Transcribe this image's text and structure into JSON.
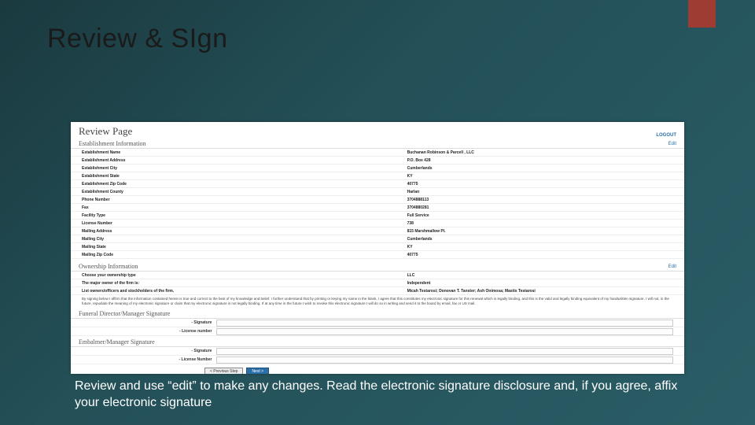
{
  "slide": {
    "title": "Review & SIgn",
    "caption": "Review and use “edit” to make any changes.  Read the electronic signature disclosure and, if you agree, affix your electronic signature"
  },
  "page": {
    "header": "Review Page",
    "logout": "LOGOUT",
    "section1_title": "Establishment Information",
    "edit": "Edit",
    "rows": [
      {
        "k": "Establishment Name",
        "v": "Buchanan Robinson & Parcell , LLC"
      },
      {
        "k": "Establishment Address",
        "v": "P.O. Box 428"
      },
      {
        "k": "Establishment City",
        "v": "Cumberlands"
      },
      {
        "k": "Establishment State",
        "v": "KY"
      },
      {
        "k": "Establishment Zip Code",
        "v": "40775"
      },
      {
        "k": "Establishment County",
        "v": "Harlan"
      },
      {
        "k": "Phone Number",
        "v": "3704888113"
      },
      {
        "k": "Fax",
        "v": "3704880281"
      },
      {
        "k": "Facility Type",
        "v": "Full Service"
      },
      {
        "k": "License Number",
        "v": "738"
      },
      {
        "k": "Mailing Address",
        "v": "815 Marshmallow Pl."
      },
      {
        "k": "Mailing City",
        "v": "Cumberlands"
      },
      {
        "k": "Mailing State",
        "v": "KY"
      },
      {
        "k": "Mailing Zip Code",
        "v": "40775"
      }
    ],
    "section2_title": "Ownership Information",
    "rows2": [
      {
        "k": "Choose your ownership type",
        "v": "LLC"
      },
      {
        "k": "The major owner of the firm is:",
        "v": "Independent"
      },
      {
        "k": "List owners/officers and stockholders of the firm.",
        "v": "Micah Testarosi; Donovan T. Tanster; Ash Onimosa; Mastis Testarosi"
      }
    ],
    "disclosure": "By signing below I affirm that the information contained herein is true and correct to the best of my knowledge and belief. I further understand that by printing or keying my name in the blank, I agree that this constitutes my electronic signature for this renewal which is legally binding, and this is the valid and legally binding equivalent of my handwritten signature. I will not, in the future, repudiate the meaning of my electronic signature or claim that my electronic signature is not legally binding. If at any time in the future I wish to revoke this electronic signature I will do so in writing and send it to the board by email, fax or US mail.",
    "section3_title": "Funeral Director/Manager Signature",
    "sig1_label_a": "- Signature",
    "sig1_label_b": "- License number",
    "section4_title": "Embalmer/Manager Signature",
    "sig2_label_a": "- Signature",
    "sig2_label_b": "- License Number",
    "btn_prev": "< Previous Step",
    "btn_next": "Next >"
  }
}
